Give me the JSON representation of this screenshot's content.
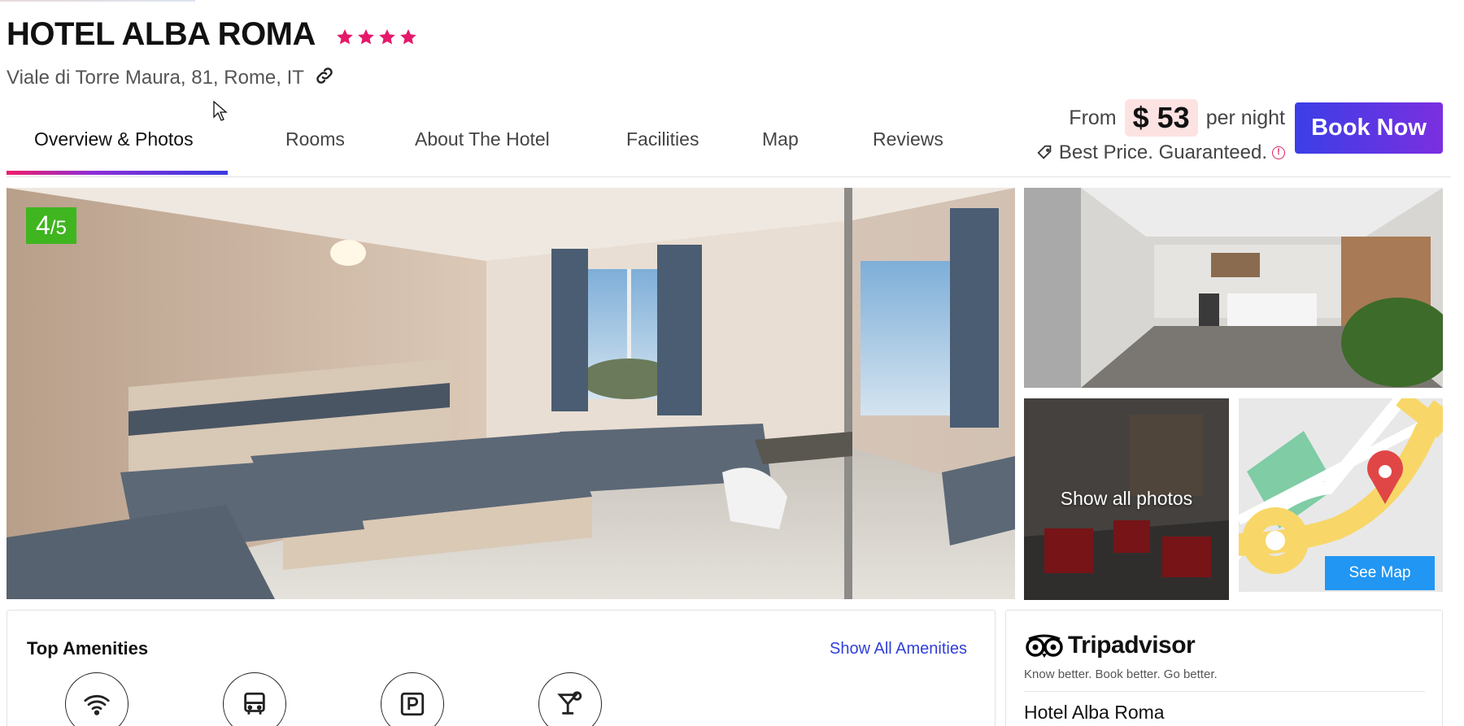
{
  "hotel": {
    "name": "HOTEL ALBA ROMA",
    "stars": 4,
    "address": "Viale di Torre Maura, 81, Rome, IT"
  },
  "tabs": [
    {
      "label": "Overview & Photos",
      "active": true
    },
    {
      "label": "Rooms",
      "active": false
    },
    {
      "label": "About The Hotel",
      "active": false
    },
    {
      "label": "Facilities",
      "active": false
    },
    {
      "label": "Map",
      "active": false
    },
    {
      "label": "Reviews",
      "active": false
    }
  ],
  "pricing": {
    "from_label": "From",
    "price": "$ 53",
    "per_night": "per night",
    "guarantee": "Best Price. Guaranteed."
  },
  "book_button": "Book Now",
  "gallery": {
    "rating_score": "4",
    "rating_max": "/5",
    "show_all_label": "Show all photos",
    "see_map_label": "See Map"
  },
  "amenities": {
    "title": "Top Amenities",
    "show_all": "Show All Amenities",
    "icons": [
      "wifi-icon",
      "bus-icon",
      "parking-icon",
      "cocktail-icon"
    ]
  },
  "tripadvisor": {
    "logo_text": "Tripadvisor",
    "tagline": "Know better. Book better. Go better.",
    "hotel_name": "Hotel Alba Roma"
  },
  "colors": {
    "star": "#e5196a",
    "book_gradient_start": "#3b3fe6",
    "book_gradient_end": "#7b2fe0",
    "rating_badge": "#3fb51f",
    "see_map": "#2196f3",
    "price_pill": "#fde2e2",
    "link": "#3340d9"
  }
}
